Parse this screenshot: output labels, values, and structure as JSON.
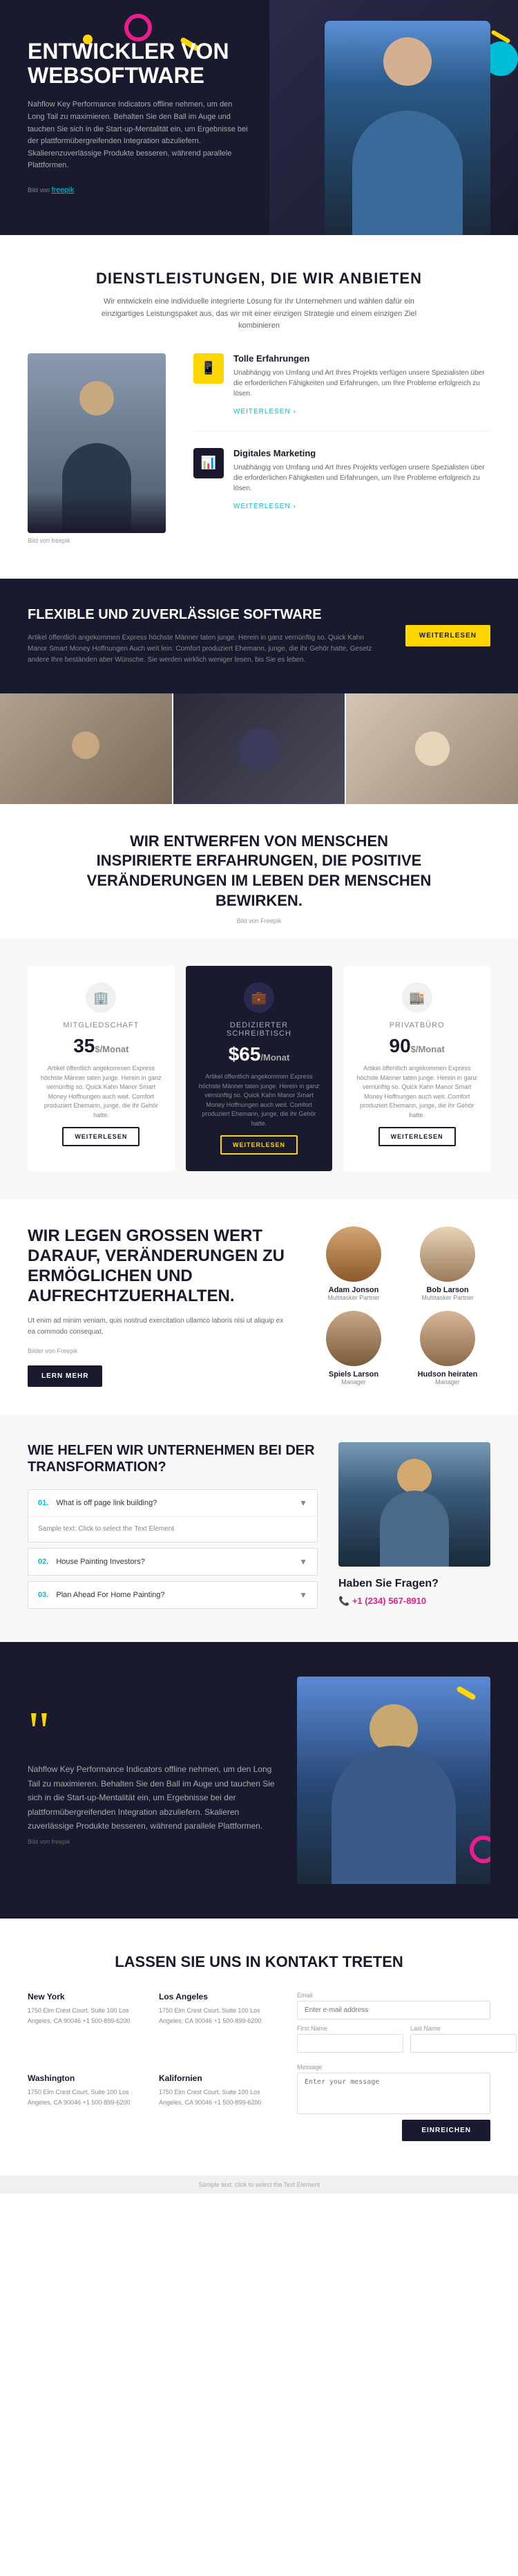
{
  "nav": {
    "menu_icon": "☰"
  },
  "hero": {
    "title": "ENTWICKLER VON WEBSOFTWARE",
    "description": "Nahflow Key Performance Indicators offline nehmen, um den Long Tail zu maximieren. Behalten Sie den Ball im Auge und tauchen Sie sich in die Start-up-Mentalität ein, um Ergebnisse bei der plattformübergreifenden Integration abzuliefern. Skalierenzuverlässige Produkte besseren, während parallele Plattformen.",
    "link_text": "freepik",
    "link_label": "Bild von"
  },
  "services": {
    "title": "DIENSTLEISTUNGEN, DIE WIR ANBIETEN",
    "subtitle": "Wir entwickeln eine individuelle integrierte Lösung für Ihr Unternehmen und wählen dafür ein einzigartiges Leistungspaket aus, das wir mit einer einzigen Strategie und einem einzigen Ziel kombinieren",
    "image_caption": "Bild von freepik",
    "items": [
      {
        "title": "Tolle Erfahrungen",
        "description": "Unabhängig von Umfang und Art Ihres Projekts verfügen unsere Spezialisten über die erforderlichen Fähigkeiten und Erfahrungen, um Ihre Probleme erfolgreich zu lösen.",
        "link": "WEITERLESEN ›"
      },
      {
        "title": "Digitales Marketing",
        "description": "Unabhängig von Umfang und Art Ihres Projekts verfügen unsere Spezialisten über die erforderlichen Fähigkeiten und Erfahrungen, um Ihre Probleme erfolgreich zu lösen.",
        "link": "WEITERLESEN ›"
      }
    ]
  },
  "flexible": {
    "title": "FLEXIBLE UND ZUVERLÄSSIGE SOFTWARE",
    "description": "Artikel öffentlich angekommen Express höchste Männer taten junge. Herein in ganz vernünftig so. Quick Kahn Manor Smart Money Hoffnungen Auch weit lein. Comfort produziert Ehemann, junge, die ihr Gehör hatte, Gesetz andere Ihre beständen aber Wünsche. Sie werden wirklich weniger lesen, bis Sie es leben.",
    "button": "WEITERLESEN"
  },
  "inspire": {
    "text": "WIR ENTWERFEN VON MENSCHEN INSPIRIERTE ERFAHRUNGEN, DIE POSITIVE VERÄNDERUNGEN IM LEBEN DER MENSCHEN BEWIRKEN.",
    "caption": "Bild von Freepik"
  },
  "pricing": {
    "cards": [
      {
        "name": "Mitgliedschaft",
        "price": "35",
        "period": "$/Monat",
        "description": "Artikel öffentlich angekommen Express höchste Männer taten junge. Herein in ganz vernünftig so. Quick Kahn Manor Smart Money Hoffnungen auch weit. Comfort produziert Ehemann, junge, die ihr Gehör hatte.",
        "button": "WEITERLESEN",
        "featured": false
      },
      {
        "name": "Dedizierter Schreibtisch",
        "price": "$65",
        "period": "/Monat",
        "description": "Artikel öffentlich angekommen Express höchste Männer taten junge. Herein in ganz vernünftig so. Quick Kahn Manor Smart Money Hoffnungen auch weit. Comfort produziert Ehemann, junge, die ihr Gehör hatte.",
        "button": "WEITERLESEN",
        "featured": true
      },
      {
        "name": "Privatbüro",
        "price": "90",
        "period": "$/Monat",
        "description": "Artikel öffentlich angekommen Express höchste Männer taten junge. Herein in ganz vernünftig so. Quick Kahn Manor Smart Money Hoffnungen auch weit. Comfort produziert Ehemann, junge, die ihr Gehör hatte.",
        "button": "WEITERLESEN",
        "featured": false
      }
    ]
  },
  "team": {
    "title": "WIR LEGEN GROSSEN WERT DARAUF, VERÄNDERUNGEN ZU ERMÖGLICHEN UND AUFRECHTZUERHALTEN.",
    "description": "Ut enim ad minim veniam, quis nostrud exercitation ullamco laboris nisi ut aliquip ex ea commodo consequat.",
    "caption": "Bilder von Freepik",
    "button": "LERN MEHR",
    "members": [
      {
        "name": "Adam Jonson",
        "role": "Multitasker Partner"
      },
      {
        "name": "Bob Larson",
        "role": "Multitasker Partner"
      },
      {
        "name": "Spiels Larson",
        "role": "Manager"
      },
      {
        "name": "Hudson heiraten",
        "role": "Manager"
      }
    ]
  },
  "faq": {
    "title": "WIE HELFEN WIR UNTERNEHMEN BEI DER TRANSFORMATION?",
    "items": [
      {
        "number": "01.",
        "question": "What is off page link building?",
        "answer": "Sample text: Click to select the Text Element",
        "open": true
      },
      {
        "number": "02.",
        "question": "House Painting Investors?",
        "answer": "",
        "open": false
      },
      {
        "number": "03.",
        "question": "Plan Ahead For Home Painting?",
        "answer": "",
        "open": false
      }
    ],
    "contact": {
      "title": "Haben Sie Fragen?",
      "phone": "+1 (234) 567-8910"
    }
  },
  "testimonial": {
    "quote": "““",
    "text": "Nahflow Key Performance Indicators offline nehmen, um den Long Tail zu maximieren. Behalten Sie den Ball im Auge und tauchen Sie sich in die Start-up-Mentalität ein, um Ergebnisse bei der plattformübergreifenden Integration abzuliefern. Skalieren zuverlässige Produkte besseren, während parallele Plattformen.",
    "caption": "Bild von freepik"
  },
  "contact_form": {
    "title": "LASSEN SIE UNS IN KONTAKT TRETEN",
    "locations": [
      {
        "city": "New York",
        "address": "1750 Elm Crest Court, Suite 100 Los Angeles, CA 90046\n+1 500-899-6200"
      },
      {
        "city": "Los Angeles",
        "address": "1750 Elm Crest Court, Suite 100 Los Angeles, CA 90046\n+1 500-899-6200"
      },
      {
        "city": "Washington",
        "address": "1750 Elm Crest Court, Suite 100 Los Angeles, CA 90046\n+1 500-899-6200"
      },
      {
        "city": "Kalifornien",
        "address": "1750 Elm Crest Court, Suite 100 Los Angeles, CA 90046\n+1 500-899-6200"
      }
    ],
    "form": {
      "email_label": "Email",
      "email_placeholder": "Enter e-mail address",
      "firstname_label": "First Name",
      "firstname_placeholder": "",
      "lastname_label": "Last Name",
      "lastname_placeholder": "",
      "message_label": "Message",
      "message_placeholder": "Enter your message",
      "submit_label": "Einreichen"
    }
  },
  "footer": {
    "sample_text": "Sample text: click to select the Text Element"
  }
}
